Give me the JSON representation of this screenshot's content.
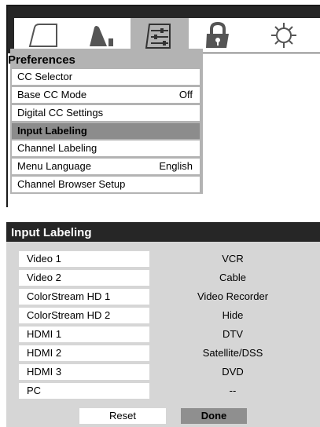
{
  "menu": {
    "tabs": [
      {
        "icon": "picture-icon"
      },
      {
        "icon": "sound-icon"
      },
      {
        "icon": "preferences-sliders-icon",
        "active": true
      },
      {
        "icon": "lock-icon"
      },
      {
        "icon": "setup-gear-icon"
      }
    ],
    "title": "Preferences",
    "items": [
      {
        "label": "CC Selector",
        "value": ""
      },
      {
        "label": "Base CC Mode",
        "value": "Off"
      },
      {
        "label": "Digital CC Settings",
        "value": ""
      },
      {
        "label": "Input Labeling",
        "value": "",
        "selected": true
      },
      {
        "label": "Channel Labeling",
        "value": ""
      },
      {
        "label": "Menu Language",
        "value": "English"
      },
      {
        "label": "Channel Browser Setup",
        "value": ""
      }
    ]
  },
  "input_labeling": {
    "title": "Input Labeling",
    "rows": [
      {
        "input": "Video 1",
        "label": "VCR"
      },
      {
        "input": "Video 2",
        "label": "Cable"
      },
      {
        "input": "ColorStream HD 1",
        "label": "Video Recorder"
      },
      {
        "input": "ColorStream HD 2",
        "label": "Hide"
      },
      {
        "input": "HDMI 1",
        "label": "DTV"
      },
      {
        "input": "HDMI 2",
        "label": "Satellite/DSS"
      },
      {
        "input": "HDMI 3",
        "label": "DVD"
      },
      {
        "input": "PC",
        "label": "--"
      }
    ],
    "reset_label": "Reset",
    "done_label": "Done"
  }
}
